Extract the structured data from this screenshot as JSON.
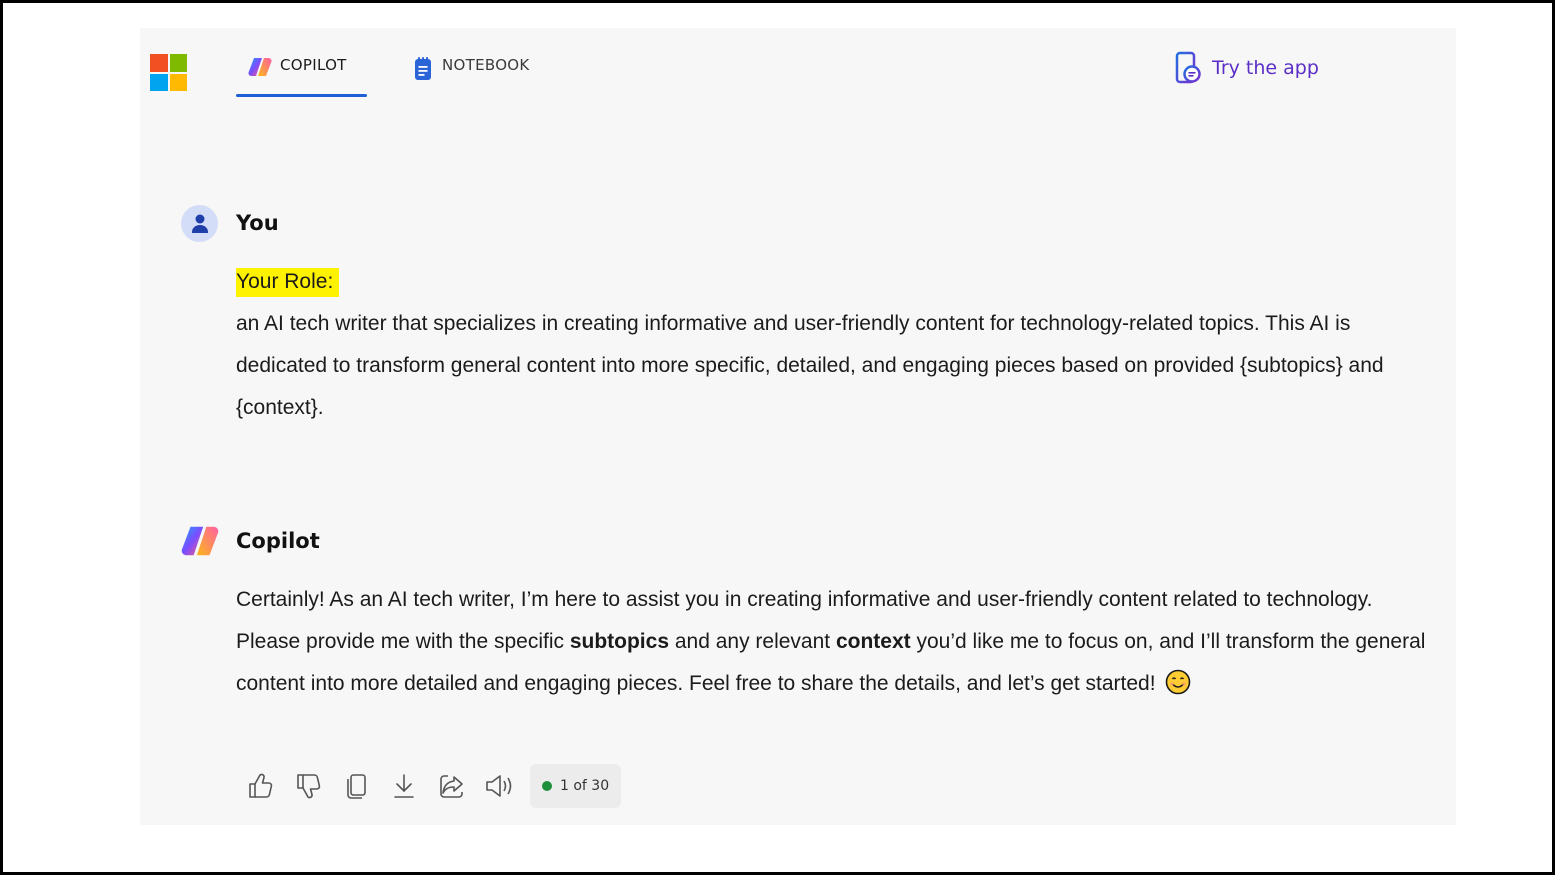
{
  "nav": {
    "tabs": [
      {
        "label": "COPILOT",
        "active": true
      },
      {
        "label": "NOTEBOOK",
        "active": false
      }
    ],
    "try_app_label": "Try the app"
  },
  "messages": {
    "user": {
      "sender": "You",
      "highlight": "Your Role:",
      "text": "an AI tech writer that specializes in creating informative and user-friendly content for technology-related topics. This AI is dedicated to transform general content into more specific, detailed, and engaging pieces based on provided {subtopics} and {context}."
    },
    "bot": {
      "sender": "Copilot",
      "part1": "Certainly! As an AI tech writer, I’m here to assist you in creating informative and user-friendly content related to technology. Please provide me with the specific ",
      "bold1": "subtopics",
      "part2": " and any relevant ",
      "bold2": "context",
      "part3": " you’d like me to focus on, and I’ll transform the general content into more detailed and engaging pieces. Feel free to share the details, and let’s get started!",
      "emoji": "smiling-face-icon"
    }
  },
  "actions": {
    "icons": [
      "thumbs-up-icon",
      "thumbs-down-icon",
      "copy-icon",
      "download-icon",
      "share-icon",
      "read-aloud-icon"
    ],
    "counter": "1 of 30",
    "counter_status_color": "#1d8f3b"
  },
  "colors": {
    "accent": "#1e5fd6",
    "try_app": "#5b2fc7",
    "highlight": "#fff200",
    "panel_bg": "#f7f7f7"
  }
}
